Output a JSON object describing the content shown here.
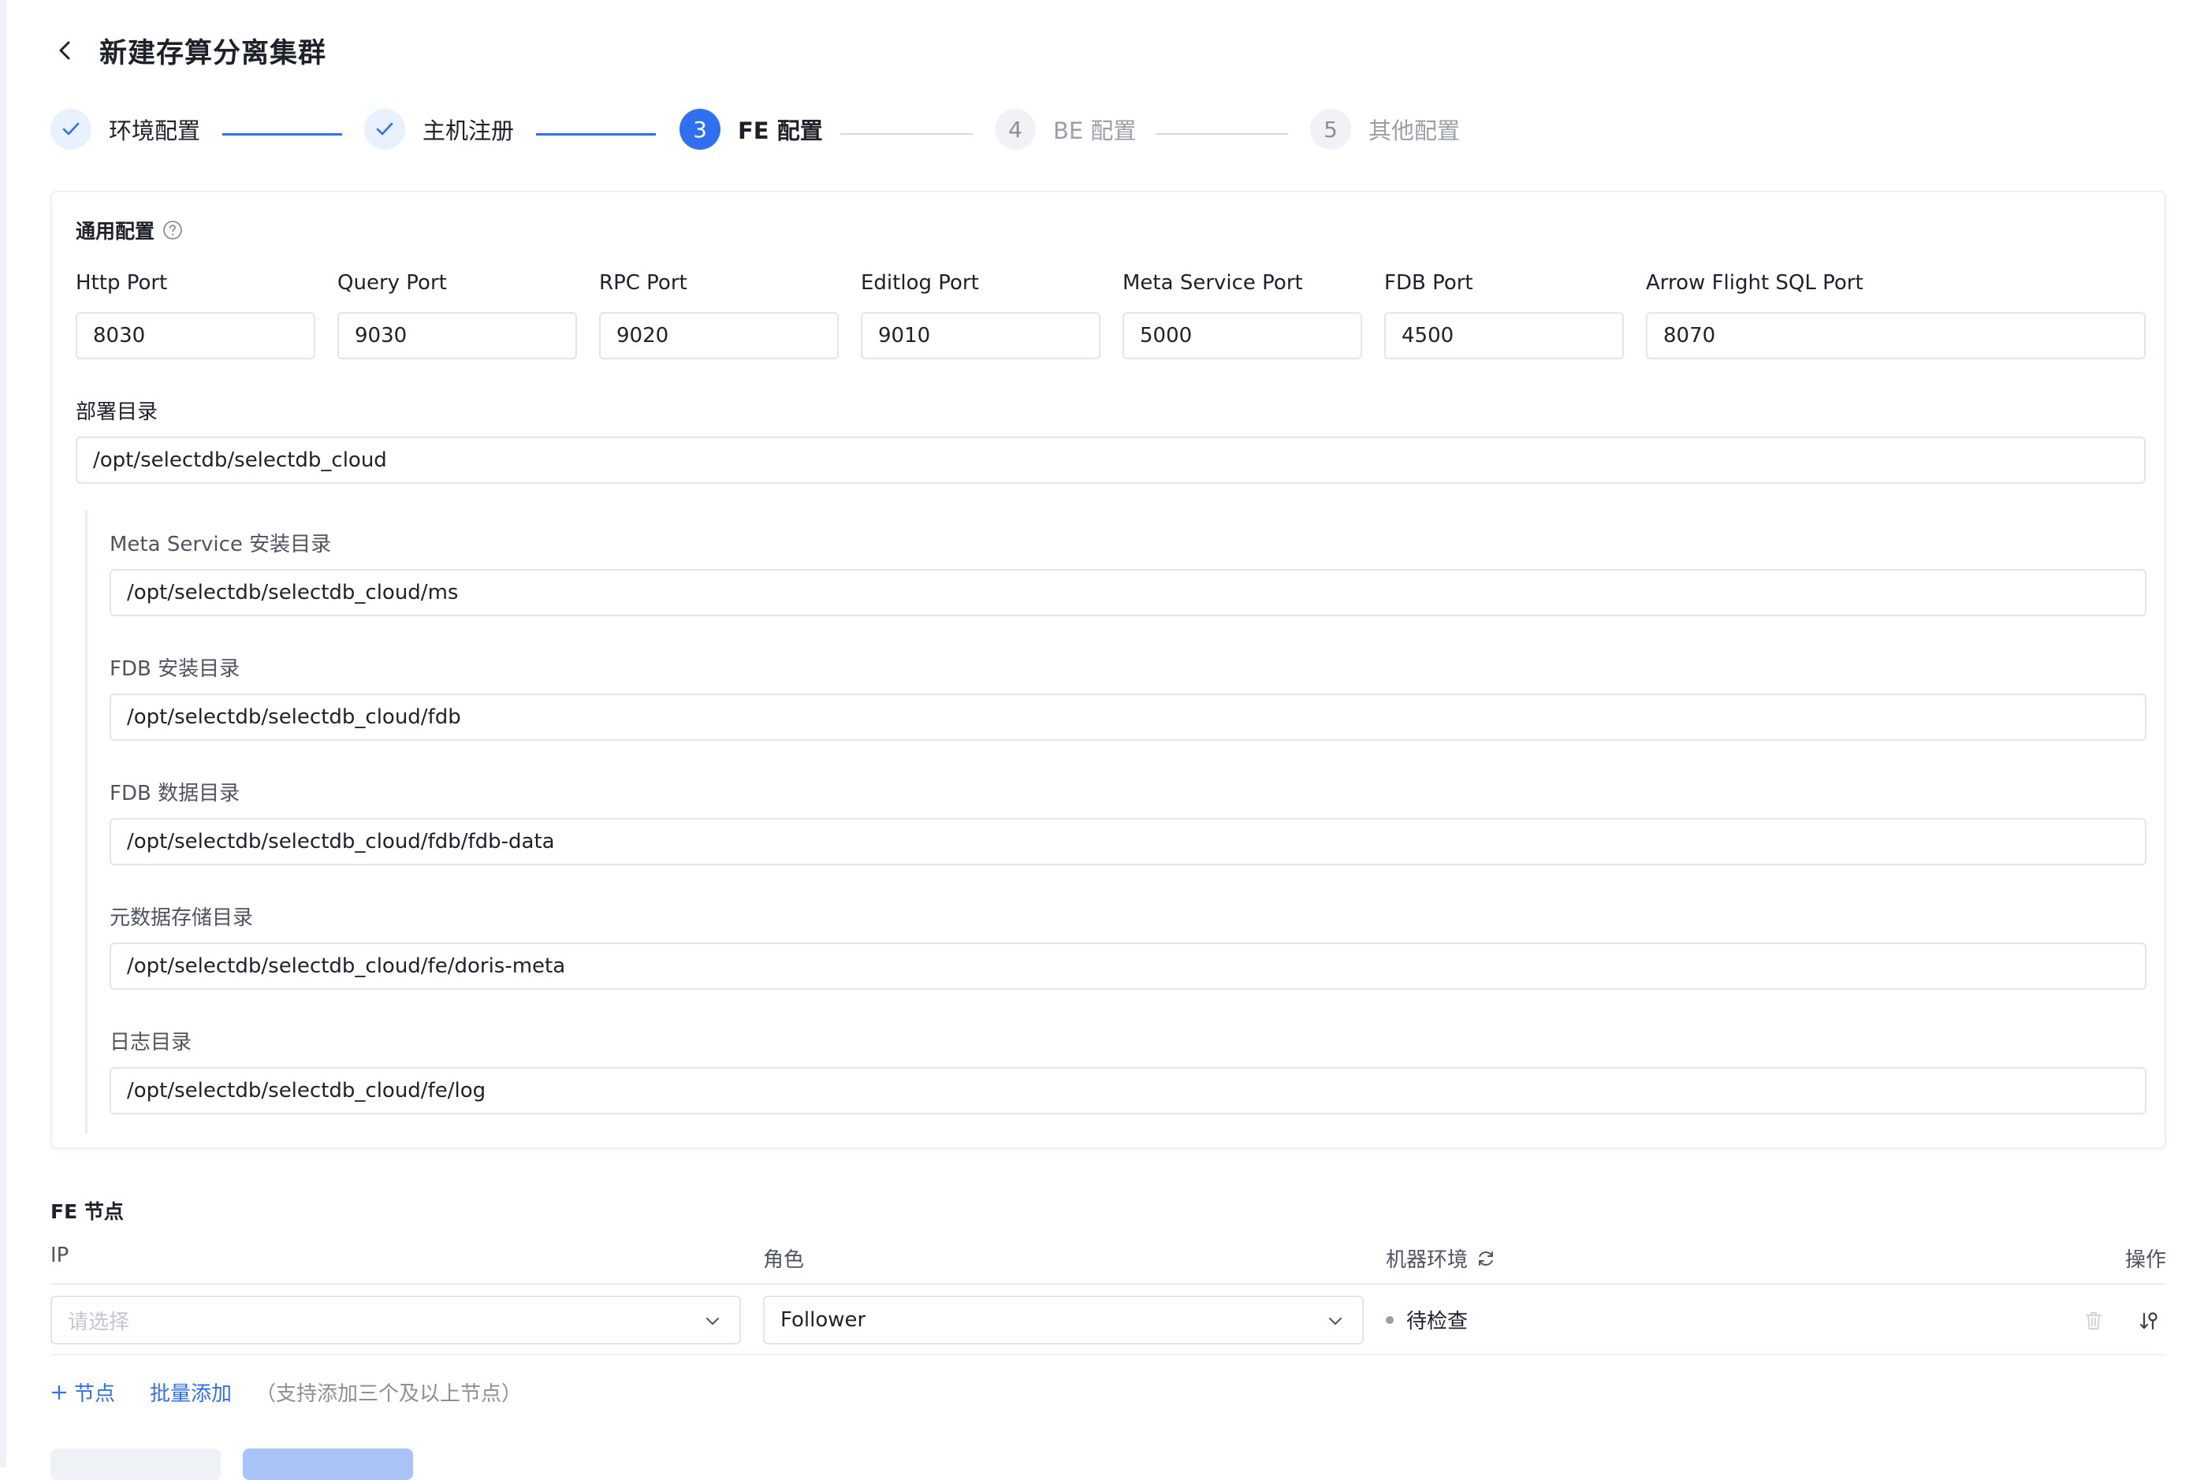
{
  "header": {
    "title": "新建存算分离集群"
  },
  "steps": [
    {
      "number": "1",
      "label": "环境配置",
      "status": "done"
    },
    {
      "number": "2",
      "label": "主机注册",
      "status": "done"
    },
    {
      "number": "3",
      "label": "FE 配置",
      "status": "active"
    },
    {
      "number": "4",
      "label": "BE 配置",
      "status": "wait"
    },
    {
      "number": "5",
      "label": "其他配置",
      "status": "wait"
    }
  ],
  "general": {
    "title": "通用配置",
    "ports": [
      {
        "label": "Http Port",
        "value": "8030"
      },
      {
        "label": "Query Port",
        "value": "9030"
      },
      {
        "label": "RPC Port",
        "value": "9020"
      },
      {
        "label": "Editlog Port",
        "value": "9010"
      },
      {
        "label": "Meta Service Port",
        "value": "5000"
      },
      {
        "label": "FDB Port",
        "value": "4500"
      },
      {
        "label": "Arrow Flight SQL Port",
        "value": "8070"
      }
    ],
    "deploy_dir": {
      "label": "部署目录",
      "value": "/opt/selectdb/selectdb_cloud"
    },
    "sub_dirs": [
      {
        "label": "Meta Service 安装目录",
        "value": "/opt/selectdb/selectdb_cloud/ms"
      },
      {
        "label": "FDB 安装目录",
        "value": "/opt/selectdb/selectdb_cloud/fdb"
      },
      {
        "label": "FDB 数据目录",
        "value": "/opt/selectdb/selectdb_cloud/fdb/fdb-data"
      },
      {
        "label": "元数据存储目录",
        "value": "/opt/selectdb/selectdb_cloud/fe/doris-meta"
      },
      {
        "label": "日志目录",
        "value": "/opt/selectdb/selectdb_cloud/fe/log"
      }
    ]
  },
  "fe_nodes": {
    "title": "FE 节点",
    "columns": {
      "ip": "IP",
      "role": "角色",
      "env": "机器环境",
      "actions": "操作"
    },
    "row": {
      "ip_placeholder": "请选择",
      "role": "Follower",
      "env_status": "待检查"
    },
    "add_node": "节点",
    "batch_add": "批量添加",
    "hint": "（支持添加三个及以上节点）"
  },
  "icons": {
    "back": "chevron-left-icon",
    "check": "check-icon",
    "help": "question-circle-icon",
    "refresh": "refresh-icon",
    "delete": "trash-icon",
    "settings": "key-settings-icon",
    "chevron": "chevron-down-icon",
    "plus": "plus-icon"
  },
  "colors": {
    "primary": "#2f6ff0",
    "step_done_bg": "#e8f1ff",
    "border": "#e2e6ec"
  }
}
